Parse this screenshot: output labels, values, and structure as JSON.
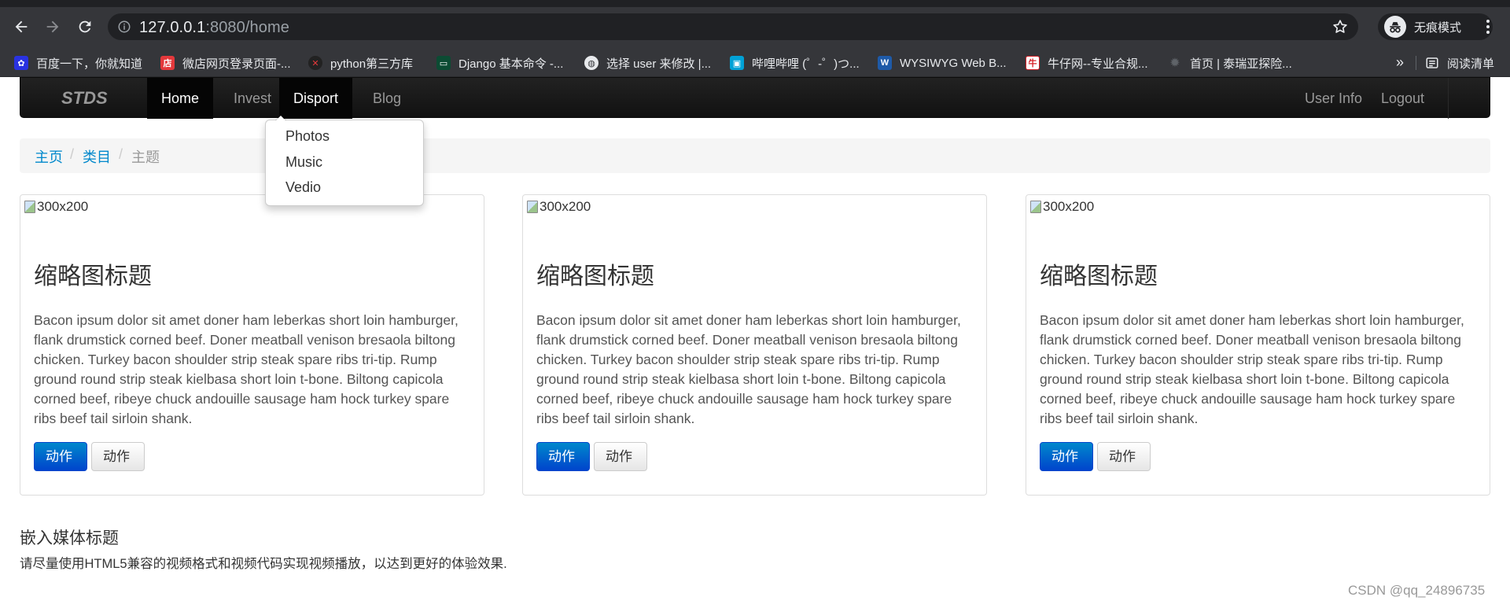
{
  "browser": {
    "url_host": "127.0.0.1",
    "url_port": ":8080/home",
    "incognito_label": "无痕模式",
    "bookmarks": [
      {
        "label": "百度一下，你就知道",
        "icon": "baidu-icon",
        "color": "#2932e1"
      },
      {
        "label": "微店网页登录页面-...",
        "icon": "weidian-icon",
        "color": "#e4393c"
      },
      {
        "label": "python第三方库",
        "icon": "python-icon",
        "color": "#222222"
      },
      {
        "label": "Django 基本命令 -...",
        "icon": "django-icon",
        "color": "#0c4b33"
      },
      {
        "label": "选择 user 来修改 |...",
        "icon": "globe-icon",
        "color": "#e8eaed"
      },
      {
        "label": "哔哩哔哩 (゜-゜)つ...",
        "icon": "bilibili-icon",
        "color": "#00a1d6"
      },
      {
        "label": "WYSIWYG Web B...",
        "icon": "wysiwyg-icon",
        "color": "#1e5aa8"
      },
      {
        "label": "牛仔网--专业合规...",
        "icon": "niuzai-icon",
        "color": "#d61f26"
      },
      {
        "label": "首页 | 泰瑞亚探险...",
        "icon": "terraria-icon",
        "color": "#5f6368"
      }
    ],
    "more_label": "»",
    "reading_list_label": "阅读清单"
  },
  "navbar": {
    "brand": "STDS",
    "items": [
      {
        "label": "Home"
      },
      {
        "label": "Invest"
      },
      {
        "label": "Disport"
      },
      {
        "label": "Blog"
      }
    ],
    "right_items": [
      {
        "label": "User Info"
      },
      {
        "label": "Logout"
      }
    ]
  },
  "dropdown": {
    "items": [
      {
        "label": "Photos"
      },
      {
        "label": "Music"
      },
      {
        "label": "Vedio"
      }
    ]
  },
  "breadcrumb": {
    "items": [
      "主页",
      "类目",
      "主题"
    ],
    "separator": "/"
  },
  "thumbnails": [
    {
      "img_alt": "300x200",
      "title": "缩略图标题",
      "body": "Bacon ipsum dolor sit amet doner ham leberkas short loin hamburger, flank drumstick corned beef. Doner meatball venison bresaola biltong chicken. Turkey bacon shoulder strip steak spare ribs tri-tip. Rump ground round strip steak kielbasa short loin t-bone. Biltong capicola corned beef, ribeye chuck andouille sausage ham hock turkey spare ribs beef tail sirloin shank.",
      "primary_label": "动作",
      "secondary_label": "动作"
    },
    {
      "img_alt": "300x200",
      "title": "缩略图标题",
      "body": "Bacon ipsum dolor sit amet doner ham leberkas short loin hamburger, flank drumstick corned beef. Doner meatball venison bresaola biltong chicken. Turkey bacon shoulder strip steak spare ribs tri-tip. Rump ground round strip steak kielbasa short loin t-bone. Biltong capicola corned beef, ribeye chuck andouille sausage ham hock turkey spare ribs beef tail sirloin shank.",
      "primary_label": "动作",
      "secondary_label": "动作"
    },
    {
      "img_alt": "300x200",
      "title": "缩略图标题",
      "body": "Bacon ipsum dolor sit amet doner ham leberkas short loin hamburger, flank drumstick corned beef. Doner meatball venison bresaola biltong chicken. Turkey bacon shoulder strip steak spare ribs tri-tip. Rump ground round strip steak kielbasa short loin t-bone. Biltong capicola corned beef, ribeye chuck andouille sausage ham hock turkey spare ribs beef tail sirloin shank.",
      "primary_label": "动作",
      "secondary_label": "动作"
    }
  ],
  "media": {
    "title": "嵌入媒体标题",
    "description": "请尽量使用HTML5兼容的视频格式和视频代码实现视频播放，以达到更好的体验效果."
  },
  "watermark": "CSDN @qq_24896735",
  "colors": {
    "link": "#0088cc",
    "primary_button": "#0044cc",
    "navbar": "#1b1b1b"
  }
}
